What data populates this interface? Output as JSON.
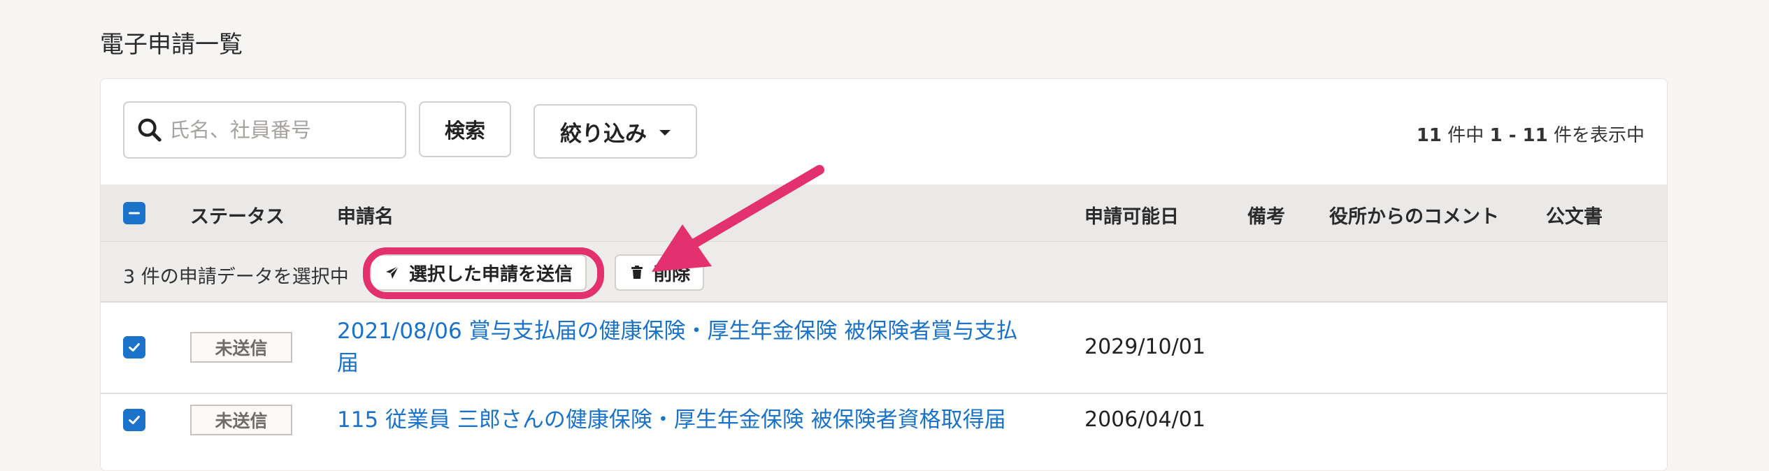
{
  "page": {
    "title": "電子申請一覧"
  },
  "toolbar": {
    "search_placeholder": "氏名、社員番号",
    "search_button": "検索",
    "filter_button": "絞り込み",
    "count_total": "11",
    "count_mid": " 件中 ",
    "count_range": "1 - 11",
    "count_suffix": " 件を表示中"
  },
  "table": {
    "headers": {
      "status": "ステータス",
      "name": "申請名",
      "available_date": "申請可能日",
      "remarks": "備考",
      "office_comment": "役所からのコメント",
      "official_document": "公文書"
    }
  },
  "selection": {
    "text": "3 件の申請データを選択中",
    "send_button": "選択した申請を送信",
    "delete_button": "削除"
  },
  "rows": [
    {
      "status": "未送信",
      "name": "2021/08/06 賞与支払届の健康保険・厚生年金保険 被保険者賞与支払届",
      "available_date": "2029/10/01",
      "checked": true
    },
    {
      "status": "未送信",
      "name": "115 従業員 三郎さんの健康保険・厚生年金保険 被保険者資格取得届",
      "available_date": "2006/04/01",
      "checked": true
    }
  ],
  "colors": {
    "accent": "#1a73c8",
    "highlight": "#e3306f",
    "background": "#f6f5f3"
  },
  "icons": {
    "search": "search-icon",
    "caret": "chevron-down-icon",
    "send": "paper-plane-icon",
    "delete": "trash-icon",
    "checkbox": "checkbox-icon"
  }
}
